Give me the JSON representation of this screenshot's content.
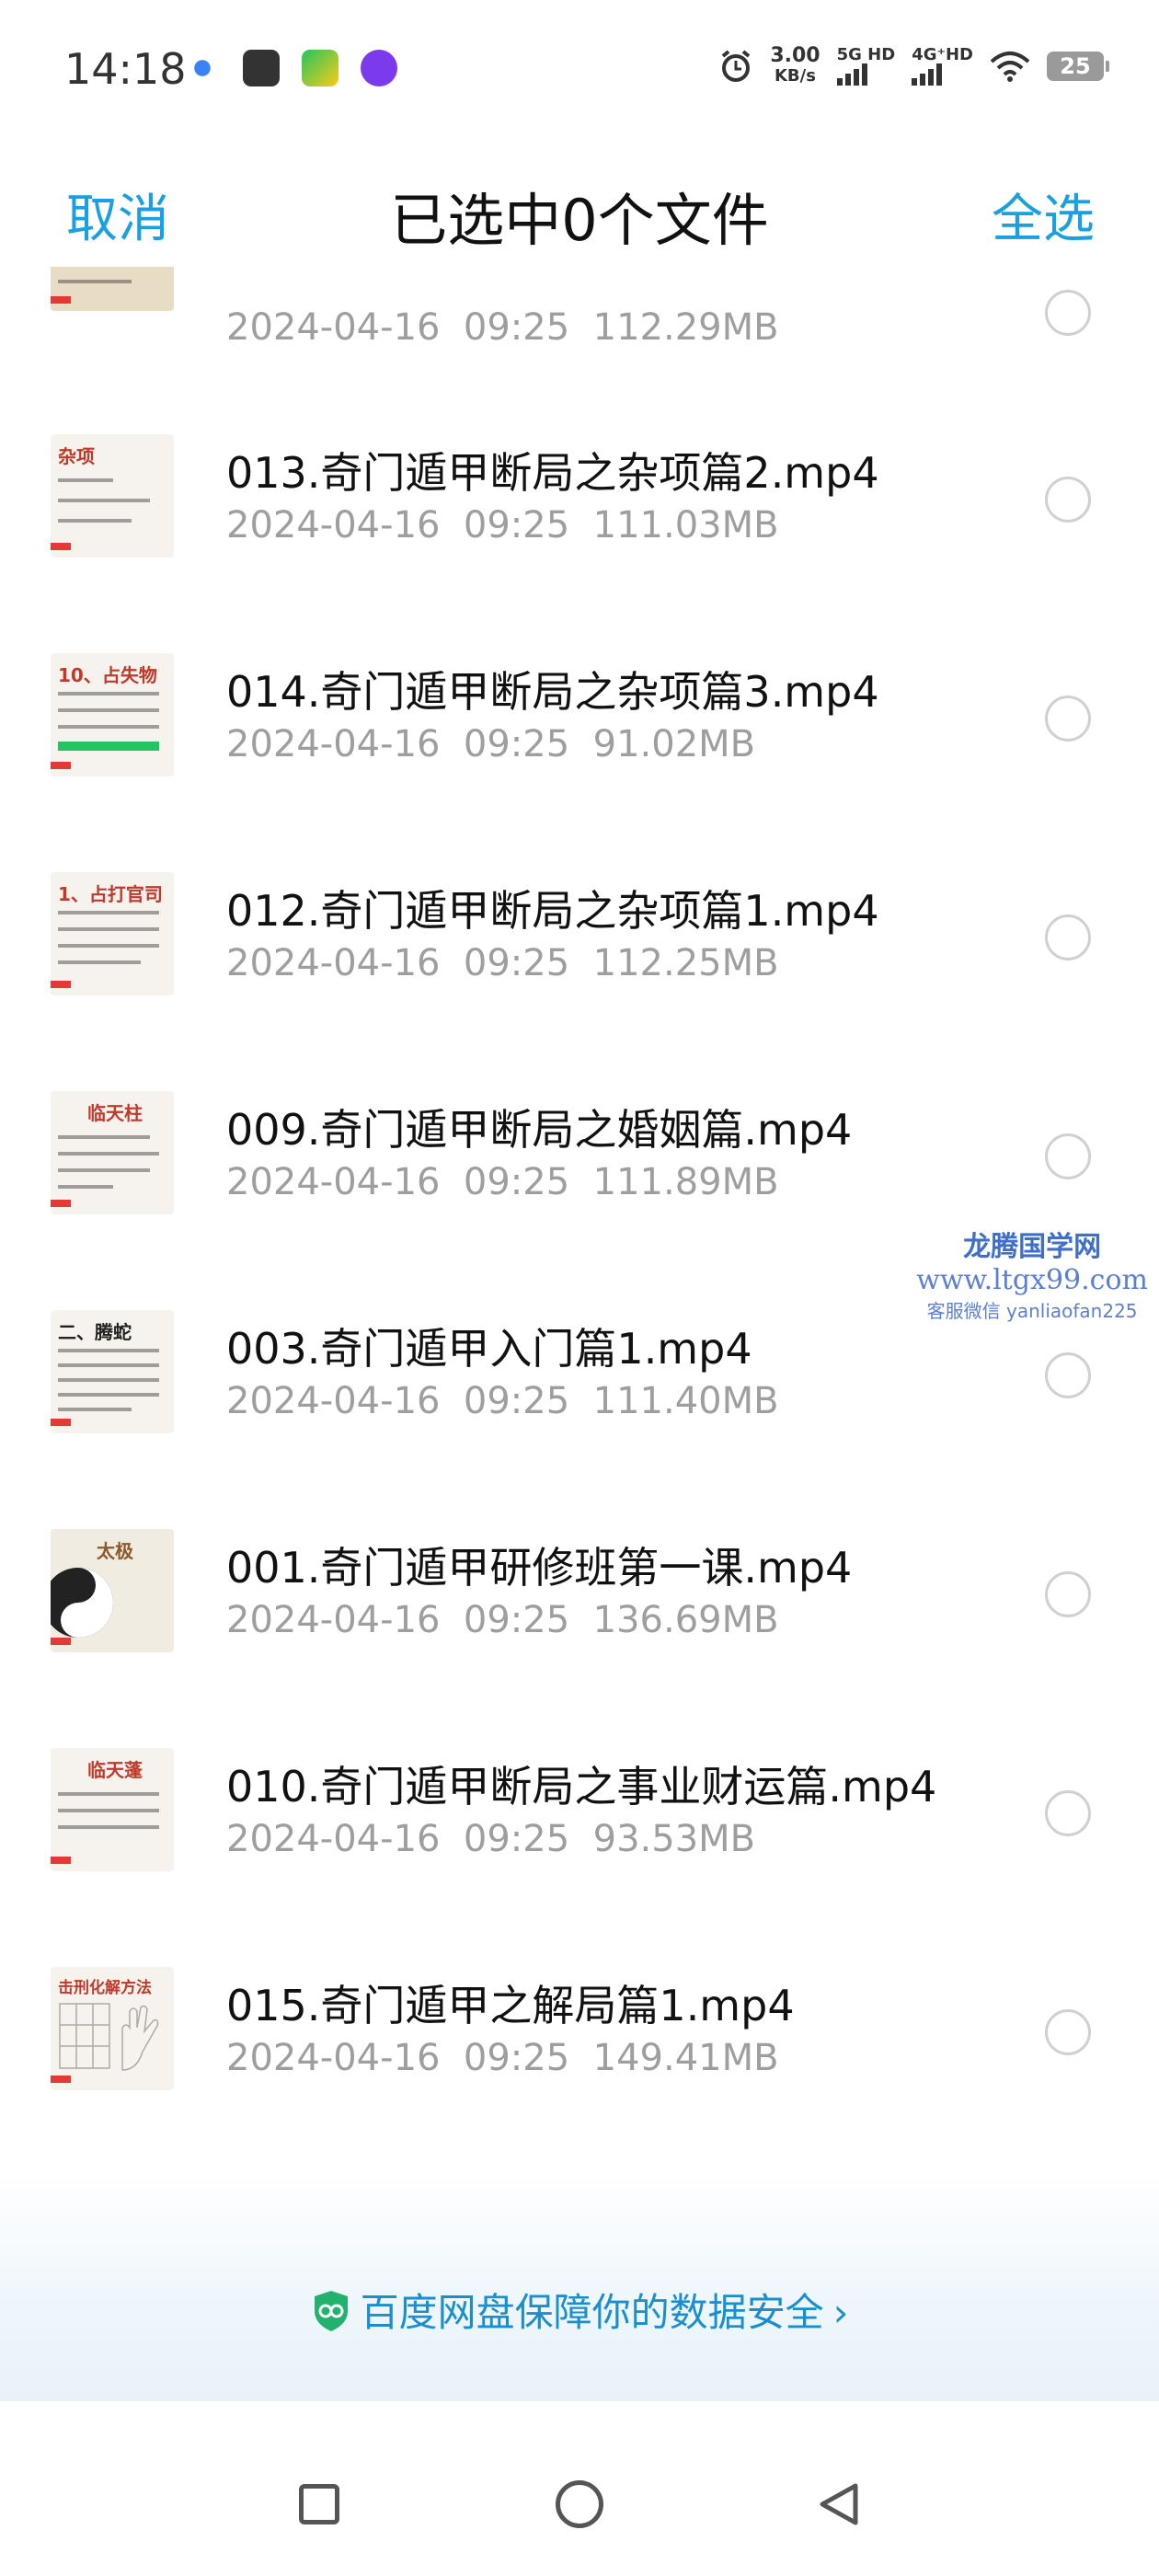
{
  "status_bar": {
    "time": "14:18",
    "speed_value": "3.00",
    "speed_unit": "KB/s",
    "net1": "5G HD",
    "net2": "4G⁺HD",
    "battery": "25",
    "app_icons": [
      "app-icon-1",
      "scissors-app-icon",
      "video-app-icon",
      "infinity-app-icon"
    ]
  },
  "header": {
    "cancel": "取消",
    "title": "已选中0个文件",
    "select_all": "全选"
  },
  "files": [
    {
      "name": "",
      "date": "2024-04-16",
      "time": "09:25",
      "size": "112.29MB",
      "thumb_title": ""
    },
    {
      "name": "013.奇门遁甲断局之杂项篇2.mp4",
      "date": "2024-04-16",
      "time": "09:25",
      "size": "111.03MB",
      "thumb_title": "杂项"
    },
    {
      "name": "014.奇门遁甲断局之杂项篇3.mp4",
      "date": "2024-04-16",
      "time": "09:25",
      "size": "91.02MB",
      "thumb_title": "10、占失物"
    },
    {
      "name": "012.奇门遁甲断局之杂项篇1.mp4",
      "date": "2024-04-16",
      "time": "09:25",
      "size": "112.25MB",
      "thumb_title": "1、占打官司"
    },
    {
      "name": "009.奇门遁甲断局之婚姻篇.mp4",
      "date": "2024-04-16",
      "time": "09:25",
      "size": "111.89MB",
      "thumb_title": "临天柱"
    },
    {
      "name": "003.奇门遁甲入门篇1.mp4",
      "date": "2024-04-16",
      "time": "09:25",
      "size": "111.40MB",
      "thumb_title": "二、腾蛇"
    },
    {
      "name": "001.奇门遁甲研修班第一课.mp4",
      "date": "2024-04-16",
      "time": "09:25",
      "size": "136.69MB",
      "thumb_title": "太极"
    },
    {
      "name": "010.奇门遁甲断局之事业财运篇.mp4",
      "date": "2024-04-16",
      "time": "09:25",
      "size": "93.53MB",
      "thumb_title": "临天蓬"
    },
    {
      "name": "015.奇门遁甲之解局篇1.mp4",
      "date": "2024-04-16",
      "time": "09:25",
      "size": "149.41MB",
      "thumb_title": "击刑化解方法"
    }
  ],
  "watermark": {
    "line1": "龙腾国学网",
    "line2": "www.ltgx99.com",
    "line3": "客服微信 yanliaofan225"
  },
  "footer": {
    "secure_text": "百度网盘保障你的数据安全",
    "chevron": "›"
  },
  "colors": {
    "accent": "#1aa0e0",
    "meta_gray": "#9e9e9e"
  }
}
